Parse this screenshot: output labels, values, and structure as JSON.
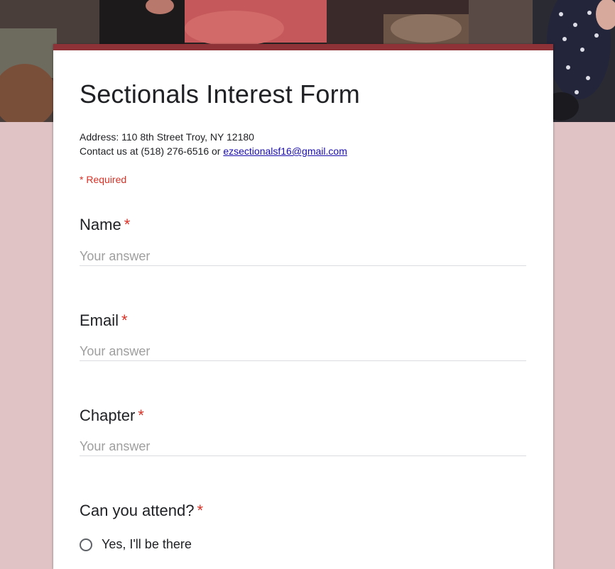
{
  "form": {
    "title": "Sectionals Interest Form",
    "description_address": "Address: 110 8th Street Troy, NY 12180",
    "description_contact": "Contact us at (518) 276-6516 or ",
    "contact_email": "ezsectionalsf16@gmail.com",
    "required_note": "* Required",
    "accent_color": "#8e3237",
    "background_color": "#e0c4c5"
  },
  "questions": [
    {
      "label": "Name",
      "required_mark": "*",
      "placeholder": "Your answer",
      "value": ""
    },
    {
      "label": "Email",
      "required_mark": "*",
      "placeholder": "Your answer",
      "value": ""
    },
    {
      "label": "Chapter",
      "required_mark": "*",
      "placeholder": "Your answer",
      "value": ""
    },
    {
      "label": "Can you attend?",
      "required_mark": "*",
      "options": [
        "Yes, I'll be there"
      ]
    }
  ]
}
